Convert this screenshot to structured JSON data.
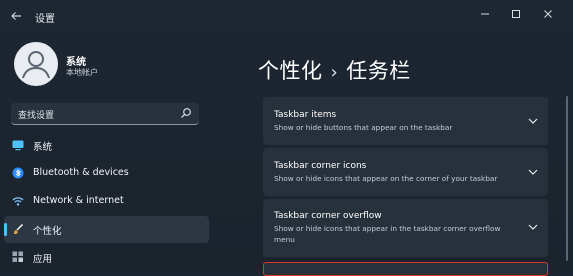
{
  "window": {
    "title": "设置",
    "back_icon": "arrow-left-icon",
    "minimize_icon": "minimize-icon",
    "maximize_icon": "maximize-icon",
    "close_icon": "close-icon"
  },
  "profile": {
    "name": "系统",
    "account_type": "本地帐户"
  },
  "search": {
    "placeholder": "查找设置"
  },
  "nav": {
    "items": [
      {
        "label": "系统",
        "icon": "display-icon",
        "color": "#4cc2ff"
      },
      {
        "label": "Bluetooth & devices",
        "icon": "bluetooth-icon",
        "color": "#2b8cff"
      },
      {
        "label": "Network & internet",
        "icon": "wifi-icon",
        "color": "#7fc7ff"
      },
      {
        "label": "个性化",
        "icon": "brush-icon",
        "color": "#ffffff"
      },
      {
        "label": "应用",
        "icon": "apps-icon",
        "color": "#9aa6b3"
      }
    ],
    "selected_index": 3
  },
  "header": {
    "parent": "个性化",
    "separator": "›",
    "current": "任务栏"
  },
  "cards": [
    {
      "title": "Taskbar items",
      "description": "Show or hide buttons that appear on the taskbar"
    },
    {
      "title": "Taskbar corner icons",
      "description": "Show or hide icons that appear on the corner of your taskbar"
    },
    {
      "title": "Taskbar corner overflow",
      "description": "Show or hide icons that appear in the taskbar corner overflow menu"
    }
  ],
  "colors": {
    "accent": "#4cc2ff",
    "highlight_border": "#d9362b"
  }
}
